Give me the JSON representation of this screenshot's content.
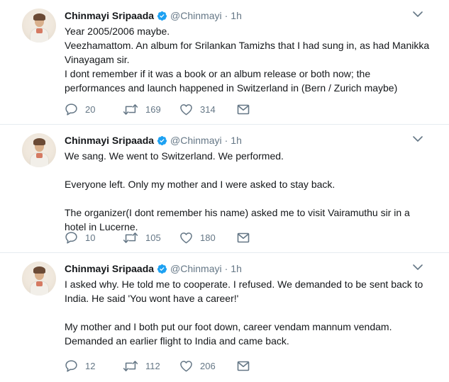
{
  "tweets": [
    {
      "author": {
        "name": "Chinmayi Sripaada",
        "handle": "@Chinmayi",
        "verified": true,
        "avatar_icon": "profile-photo"
      },
      "time": "1h",
      "paragraphs": [
        "Year 2005/2006 maybe.\nVeezhamattom. An album for Srilankan Tamizhs that I had sung in, as had Manikka Vinayagam sir.\nI dont remember if it was a book or an album release or both now; the performances and launch happened in Switzerland in (Bern / Zurich maybe)"
      ],
      "stats": {
        "replies": "20",
        "retweets": "169",
        "likes": "314"
      }
    },
    {
      "author": {
        "name": "Chinmayi Sripaada",
        "handle": "@Chinmayi",
        "verified": true,
        "avatar_icon": "profile-photo"
      },
      "time": "1h",
      "paragraphs": [
        "We sang. We went to Switzerland. We performed.\n\nEveryone left. Only my mother and I were asked to stay back.\n\nThe organizer(I dont remember his name) asked me to visit Vairamuthu sir in a hotel in Lucerne."
      ],
      "stats": {
        "replies": "10",
        "retweets": "105",
        "likes": "180"
      }
    },
    {
      "author": {
        "name": "Chinmayi Sripaada",
        "handle": "@Chinmayi",
        "verified": true,
        "avatar_icon": "profile-photo"
      },
      "time": "1h",
      "paragraphs": [
        "I asked why. He told me to cooperate. I refused. We demanded to be sent back to India. He said 'You wont have a career!'\n\nMy mother and I both put our foot down, career vendam mannum vendam.\nDemanded an earlier flight to India and came back."
      ],
      "stats": {
        "replies": "12",
        "retweets": "112",
        "likes": "206"
      }
    }
  ],
  "ui": {
    "separator": "·",
    "icons": {
      "verified": "verified-badge-icon",
      "reply": "reply-icon",
      "retweet": "retweet-icon",
      "like": "heart-icon",
      "dm": "envelope-icon",
      "more": "chevron-down-icon"
    },
    "colors": {
      "text": "#14171a",
      "secondary": "#657786",
      "verified_blue": "#1da1f2",
      "border": "#e6ecf0"
    }
  }
}
